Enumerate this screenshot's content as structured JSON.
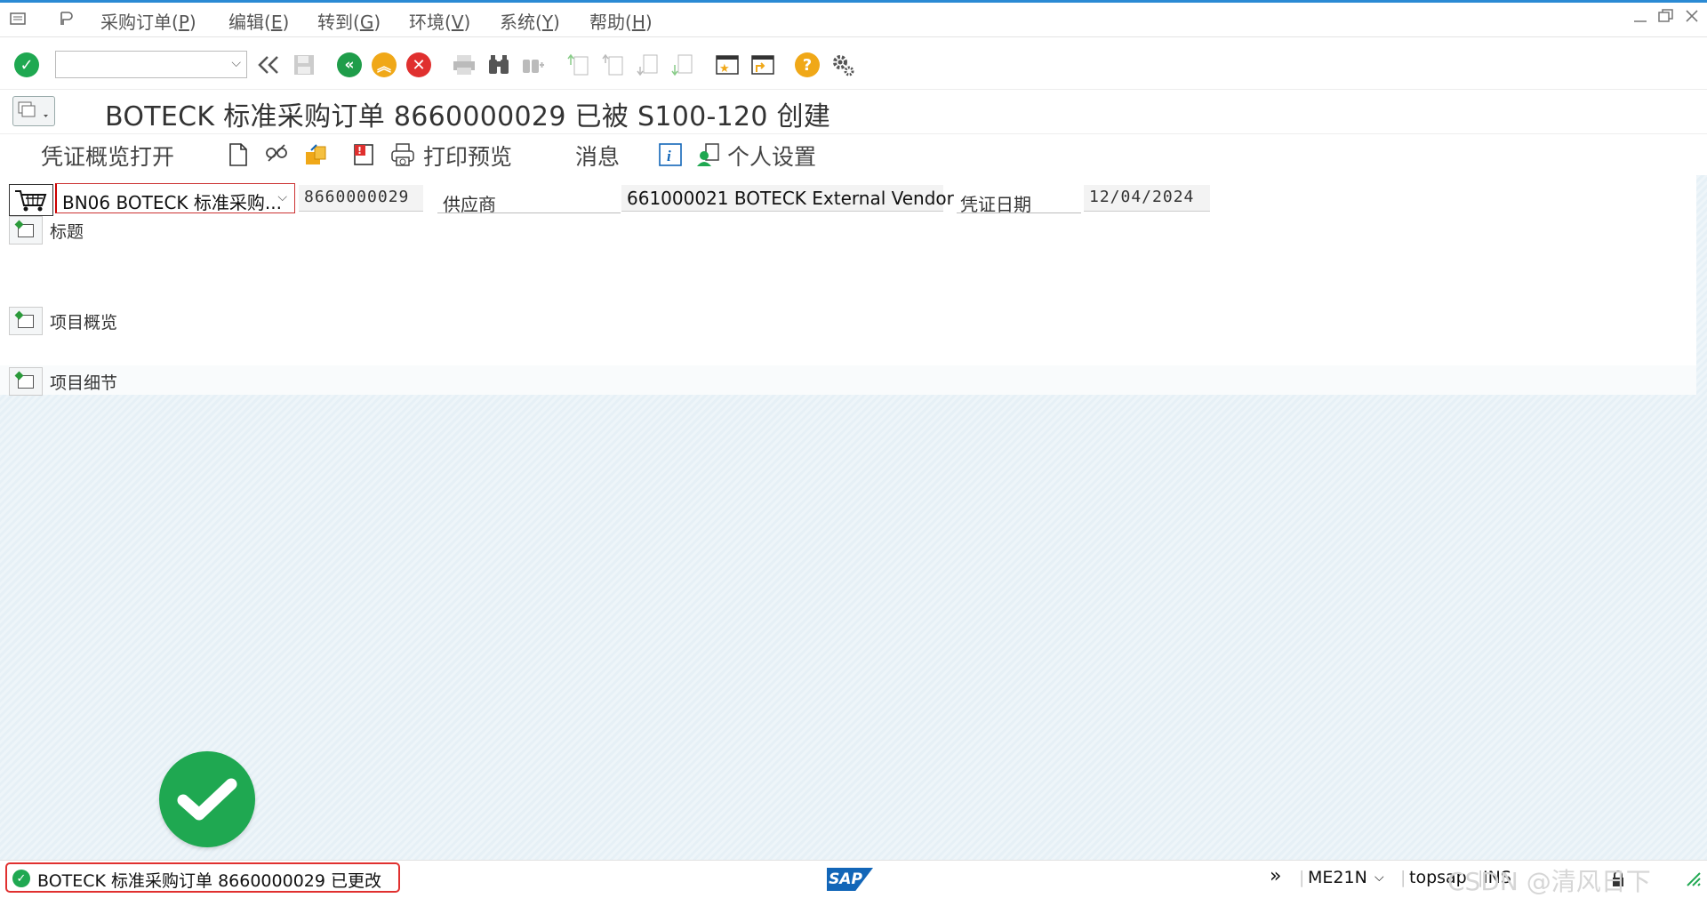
{
  "menubar": {
    "items": [
      {
        "label": "采购订单(",
        "key": "P",
        "end": ")"
      },
      {
        "label": "编辑(",
        "key": "E",
        "end": ")"
      },
      {
        "label": "转到(",
        "key": "G",
        "end": ")"
      },
      {
        "label": "环境(",
        "key": "V",
        "end": ")"
      },
      {
        "label": "系统(",
        "key": "Y",
        "end": ")"
      },
      {
        "label": "帮助(",
        "key": "H",
        "end": ")"
      }
    ]
  },
  "toolbar": {
    "command_field_value": "",
    "icons": [
      "enter-icon",
      "command-field",
      "back-double-icon",
      "save-icon",
      "back-icon",
      "exit-icon",
      "cancel-icon",
      "print-icon",
      "find-icon",
      "find-next-icon",
      "first-page-icon",
      "previous-page-icon",
      "next-page-icon",
      "last-page-icon",
      "create-session-icon",
      "shortcut-icon",
      "help-icon",
      "customize-icon"
    ]
  },
  "title": "BOTECK 标准采购订单 8660000029 已被 S100-120 创建",
  "app_toolbar": {
    "doc_overview": "凭证概览打开",
    "print_preview": "打印预览",
    "messages": "消息",
    "personal_settings": "个人设置"
  },
  "header_row": {
    "doc_type": "BN06 BOTECK 标准采购...",
    "po_number": "8660000029",
    "vendor_label": "供应商",
    "vendor_value": "661000021 BOTECK External Vendor",
    "doc_date_label": "凭证日期",
    "doc_date_value": "12/04/2024"
  },
  "sections": {
    "header": "标题",
    "item_overview": "项目概览",
    "item_detail": "项目细节"
  },
  "statusbar": {
    "message": "BOTECK 标准采购订单 8660000029 已更改",
    "transaction": "ME21N",
    "system": "topsap",
    "mode": "INS",
    "logo": "SAP",
    "watermark": "CSDN @清风日下"
  },
  "colors": {
    "success_green": "#1fa851",
    "error_red": "#e0302f",
    "sap_blue": "#1266b8"
  }
}
